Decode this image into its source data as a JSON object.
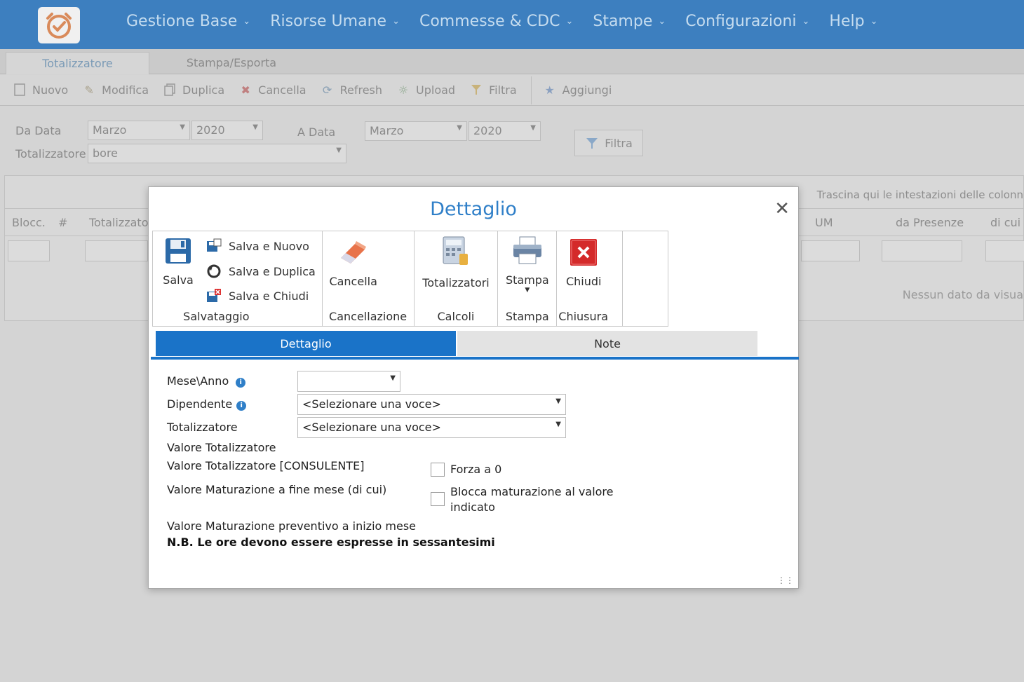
{
  "nav": {
    "items": [
      "Gestione Base",
      "Risorse Umane",
      "Commesse & CDC",
      "Stampe",
      "Configurazioni",
      "Help"
    ]
  },
  "tabs": [
    "Totalizzatore",
    "Stampa/Esporta"
  ],
  "toolbar": {
    "buttons": [
      "Nuovo",
      "Modifica",
      "Duplica",
      "Cancella",
      "Refresh",
      "Upload",
      "Filtra",
      "Aggiungi"
    ]
  },
  "filters": {
    "da_data_label": "Da Data",
    "da_mese": "Marzo",
    "da_anno": "2020",
    "a_data_label": "A Data",
    "a_mese": "Marzo",
    "a_anno": "2020",
    "totalizzatore_label": "Totalizzatore",
    "totalizzatore_value": "bore",
    "filtra_button": "Filtra"
  },
  "grid": {
    "group_hint": "Trascina qui le intestazioni delle colonn",
    "columns": [
      "Blocc.",
      "#",
      "Totalizzato",
      "UM",
      "da Presenze",
      "di cui"
    ],
    "empty_text": "Nessun dato da visua"
  },
  "dialog": {
    "title": "Dettaglio",
    "ribbon": {
      "salva": "Salva",
      "salva_nuovo": "Salva e Nuovo",
      "salva_duplica": "Salva e Duplica",
      "salva_chiudi": "Salva e Chiudi",
      "group_salvataggio": "Salvataggio",
      "cancella": "Cancella",
      "group_cancellazione": "Cancellazione",
      "totalizzatori": "Totalizzatori",
      "group_calcoli": "Calcoli",
      "stampa": "Stampa",
      "group_stampa": "Stampa",
      "chiudi": "Chiudi",
      "group_chiusura": "Chiusura"
    },
    "tabs": {
      "dettaglio": "Dettaglio",
      "note": "Note"
    },
    "form": {
      "mese_anno_label": "Mese\\Anno",
      "mese_anno_value": "",
      "dipendente_label": "Dipendente",
      "dipendente_value": "<Selezionare una voce>",
      "totalizzatore_label": "Totalizzatore",
      "totalizzatore_value": "<Selezionare una voce>",
      "valore_totalizzatore": "Valore Totalizzatore",
      "valore_consulente": "Valore Totalizzatore [CONSULENTE]",
      "forza_zero": "Forza a 0",
      "valore_maturazione": "Valore Maturazione a fine mese (di cui)",
      "blocca_maturazione_line1": "Blocca maturazione al valore",
      "blocca_maturazione_line2": "indicato",
      "valore_preventivo": "Valore Maturazione preventivo a inizio mese",
      "nota": "N.B. Le ore devono essere espresse in sessantesimi"
    }
  },
  "colors": {
    "accent": "#1a73c8",
    "topbar": "#3d7fbf",
    "title": "#2f7fc8"
  }
}
